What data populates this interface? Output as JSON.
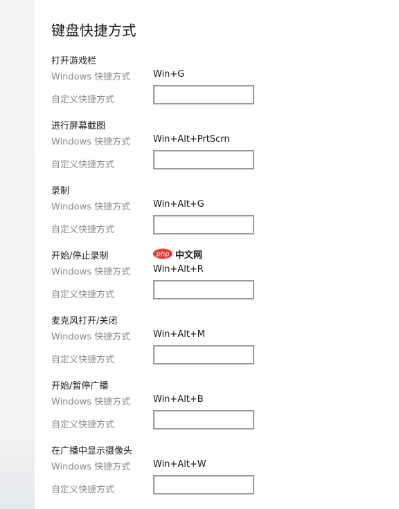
{
  "page": {
    "title": "键盘快捷方式"
  },
  "labels": {
    "windows_shortcut": "Windows 快捷方式",
    "custom_shortcut": "自定义快捷方式"
  },
  "sections": [
    {
      "title": "打开游戏栏",
      "windows_shortcut": "Win+G",
      "custom_value": ""
    },
    {
      "title": "进行屏幕截图",
      "windows_shortcut": "Win+Alt+PrtScrn",
      "custom_value": ""
    },
    {
      "title": "录制",
      "windows_shortcut": "Win+Alt+G",
      "custom_value": ""
    },
    {
      "title": "开始/停止录制",
      "windows_shortcut": "Win+Alt+R",
      "custom_value": ""
    },
    {
      "title": "麦克风打开/关闭",
      "windows_shortcut": "Win+Alt+M",
      "custom_value": ""
    },
    {
      "title": "开始/暂停广播",
      "windows_shortcut": "Win+Alt+B",
      "custom_value": ""
    },
    {
      "title": "在广播中显示摄像头",
      "windows_shortcut": "Win+Alt+W",
      "custom_value": ""
    }
  ],
  "watermark": {
    "logo_text": "php",
    "text": "中文网",
    "logo_color": "#e53935"
  }
}
